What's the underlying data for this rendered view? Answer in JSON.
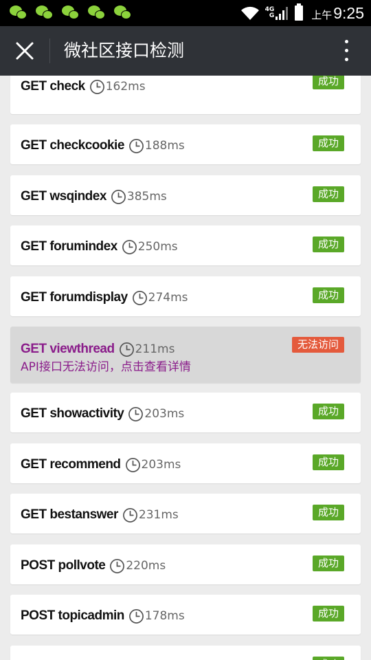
{
  "status_bar": {
    "network_label_top": "4G",
    "network_label_bottom": "G",
    "time_prefix": "上午",
    "time": "9:25"
  },
  "header": {
    "title": "微社区接口检测",
    "close_icon": "close-icon",
    "more_icon": "more-vertical-icon"
  },
  "colors": {
    "header_bg": "#2f3237",
    "success": "#5aa828",
    "fail": "#e45a3c",
    "error_text": "#8a1c8a"
  },
  "items": [
    {
      "endpoint": "GET check",
      "duration": "162ms",
      "status": "成功"
    },
    {
      "endpoint": "GET checkcookie",
      "duration": "188ms",
      "status": "成功"
    },
    {
      "endpoint": "GET wsqindex",
      "duration": "385ms",
      "status": "成功"
    },
    {
      "endpoint": "GET forumindex",
      "duration": "250ms",
      "status": "成功"
    },
    {
      "endpoint": "GET forumdisplay",
      "duration": "274ms",
      "status": "成功"
    },
    {
      "endpoint": "GET viewthread",
      "duration": "211ms",
      "status": "无法访问",
      "message": "API接口无法访问，点击查看详情"
    },
    {
      "endpoint": "GET showactivity",
      "duration": "203ms",
      "status": "成功"
    },
    {
      "endpoint": "GET recommend",
      "duration": "203ms",
      "status": "成功"
    },
    {
      "endpoint": "GET bestanswer",
      "duration": "231ms",
      "status": "成功"
    },
    {
      "endpoint": "POST pollvote",
      "duration": "220ms",
      "status": "成功"
    },
    {
      "endpoint": "POST topicadmin",
      "duration": "178ms",
      "status": "成功"
    },
    {
      "endpoint": "",
      "duration": "",
      "status": "成功"
    }
  ]
}
